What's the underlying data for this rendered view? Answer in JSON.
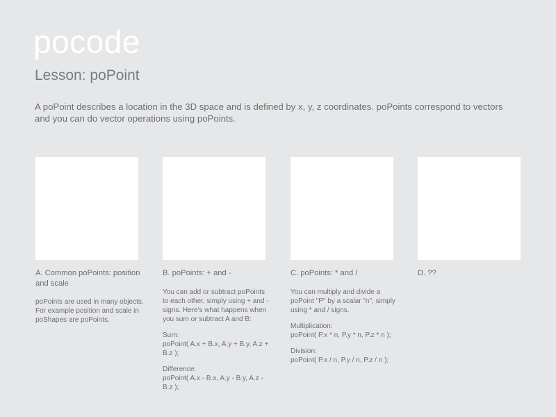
{
  "header": {
    "brand": "pocode",
    "lesson": "Lesson: poPoint",
    "intro_line1": "A poPoint describes a location in the 3D space and is defined by x, y, z coordinates. poPoints correspond to vectors",
    "intro_line2": "and you can do vector operations using poPoints."
  },
  "cards": [
    {
      "title_line1": "A. Common poPoints: position",
      "title_line2": "and scale",
      "body_line1": "poPoints are used in many objects.",
      "body_line2": "For example position and scale in",
      "body_line3": "poShapes are poPoints."
    },
    {
      "title_line1": "B. poPoints: + and -",
      "body_line1": "You can add or subtract poPoints",
      "body_line2": "to each other, simply using + and -",
      "body_line3": "signs. Here's what happens when",
      "body_line4": "you sum or subtract A and B:",
      "sum_label": "Sum:",
      "sum_code": "poPoint( A.x + B.x, A.y + B.y, A.z + B.z );",
      "diff_label": "Difference:",
      "diff_code": "poPoint( A.x - B.x, A.y - B.y, A.z - B.z );"
    },
    {
      "title_line1": "C. poPoints: * and /",
      "body_line1": "You can multiply and divide a",
      "body_line2": "poPoint \"P\" by a scalar \"n\", simply",
      "body_line3": "using * and / signs.",
      "mult_label": "Multiplication:",
      "mult_code": "poPoint( P.x * n,  P.y * n,  P.z * n );",
      "div_label": "Division:",
      "div_code": "poPoint( P.x / n, P.y / n, P.z / n );"
    },
    {
      "title_line1": "D. ??"
    }
  ]
}
